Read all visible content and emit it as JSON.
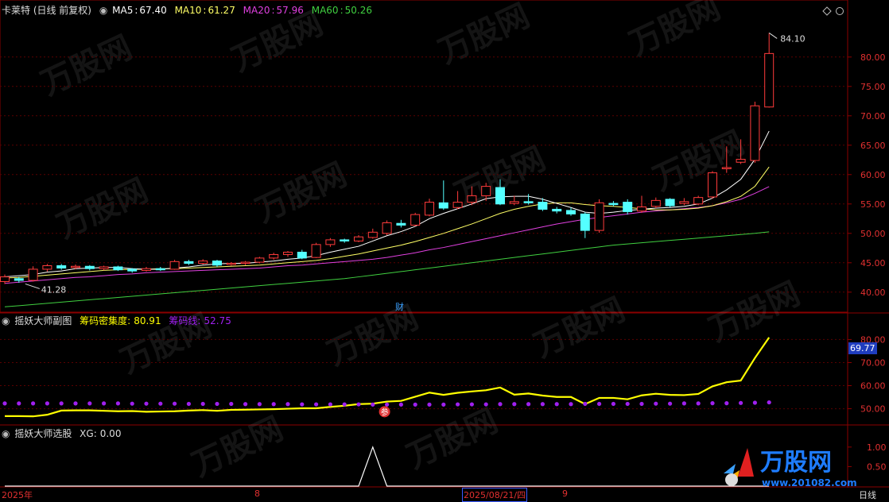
{
  "chart_data": [
    {
      "type": "candlestick",
      "title": "卡莱特 (日线 前复权)",
      "indicators": [
        {
          "name": "MA5",
          "value": "67.40",
          "color": "#ffffff"
        },
        {
          "name": "MA10",
          "value": "61.27",
          "color": "#ffff66"
        },
        {
          "name": "MA20",
          "value": "57.96",
          "color": "#e040e0"
        },
        {
          "name": "MA60",
          "value": "50.26",
          "color": "#40d040"
        }
      ],
      "ylim": [
        37,
        87
      ],
      "yticks": [
        "80.00",
        "75.00",
        "70.00",
        "65.00",
        "60.00",
        "55.00",
        "50.00",
        "45.00",
        "40.00"
      ],
      "high_label": "84.10",
      "low_label": "41.28",
      "annotation": "财",
      "candles": [
        [
          41.8,
          42.6,
          43.0,
          41.4
        ],
        [
          42.3,
          42.0,
          42.6,
          41.6
        ],
        [
          42.0,
          43.9,
          44.4,
          41.8
        ],
        [
          43.9,
          44.5,
          44.8,
          43.5
        ],
        [
          44.5,
          44.1,
          44.8,
          43.8
        ],
        [
          44.2,
          44.4,
          44.7,
          43.9
        ],
        [
          44.4,
          44.0,
          44.6,
          43.7
        ],
        [
          44.0,
          44.3,
          44.5,
          43.7
        ],
        [
          44.3,
          43.8,
          44.5,
          43.6
        ],
        [
          43.9,
          43.6,
          44.1,
          43.3
        ],
        [
          43.7,
          44.0,
          44.3,
          43.5
        ],
        [
          44.0,
          43.8,
          44.3,
          43.6
        ],
        [
          43.9,
          45.2,
          45.5,
          43.8
        ],
        [
          45.2,
          44.9,
          45.5,
          44.6
        ],
        [
          44.9,
          45.3,
          45.6,
          44.7
        ],
        [
          45.3,
          44.6,
          45.5,
          44.3
        ],
        [
          44.7,
          44.9,
          45.1,
          44.5
        ],
        [
          44.9,
          45.1,
          45.3,
          44.6
        ],
        [
          45.1,
          45.8,
          46.0,
          44.9
        ],
        [
          45.8,
          46.4,
          46.7,
          45.5
        ],
        [
          46.4,
          46.8,
          47.0,
          46.0
        ],
        [
          46.8,
          45.8,
          47.2,
          45.6
        ],
        [
          45.9,
          48.1,
          48.4,
          45.8
        ],
        [
          48.1,
          48.9,
          49.2,
          47.7
        ],
        [
          48.9,
          48.7,
          49.1,
          48.4
        ],
        [
          48.7,
          49.4,
          49.7,
          48.5
        ],
        [
          49.3,
          50.2,
          50.8,
          49.1
        ],
        [
          50.0,
          51.8,
          52.2,
          49.7
        ],
        [
          51.7,
          51.4,
          52.3,
          51.0
        ],
        [
          51.4,
          53.2,
          53.5,
          51.2
        ],
        [
          53.1,
          55.3,
          55.9,
          52.9
        ],
        [
          55.2,
          54.3,
          59.0,
          54.0
        ],
        [
          54.4,
          55.3,
          57.2,
          54.1
        ],
        [
          55.3,
          56.4,
          58.0,
          54.8
        ],
        [
          56.4,
          58.0,
          58.6,
          55.5
        ],
        [
          57.8,
          55.0,
          59.2,
          54.8
        ],
        [
          55.1,
          55.4,
          56.4,
          54.8
        ],
        [
          55.4,
          55.2,
          56.7,
          54.9
        ],
        [
          55.3,
          54.1,
          56.0,
          53.8
        ],
        [
          54.1,
          53.8,
          54.5,
          53.4
        ],
        [
          53.9,
          53.3,
          54.4,
          53.0
        ],
        [
          53.3,
          50.5,
          53.6,
          49.2
        ],
        [
          50.5,
          55.2,
          55.8,
          50.1
        ],
        [
          55.1,
          55.0,
          55.5,
          54.6
        ],
        [
          55.3,
          53.7,
          55.8,
          53.2
        ],
        [
          53.8,
          54.5,
          56.4,
          53.5
        ],
        [
          54.6,
          55.6,
          56.1,
          54.3
        ],
        [
          55.8,
          54.7,
          56.0,
          54.4
        ],
        [
          55.1,
          55.4,
          56.0,
          54.8
        ],
        [
          55.0,
          56.1,
          56.4,
          54.8
        ],
        [
          56.2,
          60.3,
          60.6,
          55.9
        ],
        [
          61.2,
          61.2,
          64.8,
          60.3
        ],
        [
          62.1,
          62.6,
          66.0,
          61.8
        ],
        [
          62.4,
          71.7,
          72.4,
          62.0
        ],
        [
          71.5,
          80.6,
          84.1,
          71.4
        ]
      ],
      "series": [
        {
          "name": "MA5",
          "color": "#ffffff",
          "values": [
            42.6,
            42.8,
            43.0,
            43.4,
            43.6,
            44.0,
            44.1,
            44.2,
            44.2,
            44.0,
            43.9,
            43.9,
            44.1,
            44.3,
            44.6,
            44.8,
            44.9,
            44.9,
            45.1,
            45.3,
            45.6,
            45.8,
            46.2,
            46.8,
            47.3,
            47.8,
            48.7,
            49.6,
            50.3,
            51.2,
            52.5,
            53.4,
            54.2,
            55.0,
            55.9,
            56.2,
            56.3,
            56.3,
            55.8,
            55.1,
            54.4,
            53.6,
            53.4,
            53.6,
            53.9,
            54.1,
            54.3,
            54.4,
            54.6,
            55.0,
            56.0,
            57.4,
            59.2,
            62.6,
            67.4
          ]
        },
        {
          "name": "MA10",
          "color": "#ffff66",
          "values": [
            42.4,
            42.5,
            42.7,
            42.9,
            43.1,
            43.3,
            43.5,
            43.7,
            43.8,
            43.9,
            43.9,
            44.0,
            44.0,
            44.1,
            44.2,
            44.3,
            44.4,
            44.5,
            44.6,
            44.8,
            45.0,
            45.2,
            45.4,
            45.7,
            46.1,
            46.5,
            47.0,
            47.5,
            48.0,
            48.6,
            49.3,
            50.0,
            50.8,
            51.6,
            52.5,
            53.4,
            54.1,
            54.6,
            55.0,
            55.2,
            55.2,
            54.9,
            54.7,
            54.6,
            54.4,
            54.2,
            54.0,
            54.0,
            54.1,
            54.3,
            54.7,
            55.4,
            56.3,
            58.0,
            61.3
          ]
        },
        {
          "name": "MA20",
          "color": "#e040e0",
          "values": [
            41.5,
            41.7,
            41.9,
            42.1,
            42.3,
            42.5,
            42.6,
            42.8,
            43.0,
            43.1,
            43.3,
            43.4,
            43.5,
            43.6,
            43.7,
            43.8,
            43.9,
            44.0,
            44.1,
            44.3,
            44.5,
            44.6,
            44.8,
            45.0,
            45.2,
            45.4,
            45.6,
            45.9,
            46.3,
            46.7,
            47.2,
            47.6,
            48.1,
            48.6,
            49.1,
            49.6,
            50.1,
            50.6,
            51.1,
            51.6,
            52.0,
            52.4,
            52.7,
            53.0,
            53.3,
            53.6,
            53.8,
            54.0,
            54.2,
            54.4,
            54.7,
            55.2,
            55.8,
            56.8,
            57.96
          ]
        },
        {
          "name": "MA60",
          "color": "#40d040",
          "values": [
            37.5,
            37.7,
            37.9,
            38.1,
            38.3,
            38.5,
            38.7,
            38.9,
            39.1,
            39.3,
            39.5,
            39.7,
            39.9,
            40.1,
            40.3,
            40.5,
            40.7,
            40.9,
            41.1,
            41.3,
            41.5,
            41.7,
            41.9,
            42.1,
            42.3,
            42.6,
            42.9,
            43.2,
            43.5,
            43.8,
            44.1,
            44.4,
            44.7,
            45.0,
            45.3,
            45.6,
            45.9,
            46.2,
            46.5,
            46.8,
            47.1,
            47.4,
            47.7,
            48.0,
            48.2,
            48.4,
            48.6,
            48.8,
            49.0,
            49.2,
            49.4,
            49.6,
            49.8,
            50.0,
            50.26
          ]
        }
      ]
    },
    {
      "type": "line",
      "title": "摇妖大师副图",
      "ylim": [
        44,
        86
      ],
      "yticks": [
        "80.00",
        "70.00",
        "60.00",
        "50.00"
      ],
      "current_label": "69.77",
      "marker_label": "参",
      "series": [
        {
          "name": "筹码密集度",
          "value": "80.91",
          "color": "#ffff00",
          "values": [
            46.8,
            46.8,
            46.7,
            47.4,
            49.2,
            49.3,
            49.3,
            49.1,
            48.9,
            49.0,
            48.7,
            48.8,
            48.9,
            49.2,
            49.4,
            49.1,
            49.5,
            49.6,
            49.7,
            49.8,
            50.0,
            50.2,
            50.2,
            50.8,
            51.3,
            52.0,
            52.2,
            53.1,
            53.4,
            55.2,
            57.0,
            56.0,
            56.9,
            57.5,
            58.0,
            59.2,
            56.1,
            56.6,
            55.7,
            55.1,
            55.1,
            52.0,
            54.7,
            54.7,
            54.1,
            55.8,
            56.5,
            56.0,
            55.9,
            56.4,
            59.7,
            61.5,
            62.2,
            72.0,
            80.9
          ]
        },
        {
          "name": "筹码线",
          "value": "52.75",
          "color": "#a020f0",
          "values": [
            52.3,
            52.3,
            52.3,
            52.3,
            52.3,
            52.3,
            52.3,
            52.3,
            52.3,
            52.2,
            52.2,
            52.2,
            52.2,
            52.1,
            52.1,
            52.1,
            52.1,
            52.0,
            52.0,
            52.0,
            52.0,
            51.9,
            51.9,
            51.9,
            51.9,
            51.9,
            51.8,
            51.8,
            51.8,
            51.8,
            51.8,
            51.8,
            51.9,
            51.9,
            51.9,
            52.0,
            52.0,
            52.0,
            52.0,
            52.0,
            52.0,
            52.1,
            52.1,
            52.1,
            52.1,
            52.1,
            52.2,
            52.2,
            52.3,
            52.3,
            52.4,
            52.4,
            52.5,
            52.6,
            52.75
          ]
        }
      ]
    },
    {
      "type": "line",
      "title": "摇妖大师选股",
      "ylim": [
        0,
        1.2
      ],
      "yticks": [
        "1.00",
        "0.50"
      ],
      "series": [
        {
          "name": "XG",
          "value": "0.00",
          "color": "#ffffff",
          "values": [
            0,
            0,
            0,
            0,
            0,
            0,
            0,
            0,
            0,
            0,
            0,
            0,
            0,
            0,
            0,
            0,
            0,
            0,
            0,
            0,
            0,
            0,
            0,
            0,
            0,
            0,
            1,
            0,
            0,
            0,
            0,
            0,
            0,
            0,
            0,
            0,
            0,
            0,
            0,
            0,
            0,
            0,
            0,
            0,
            0,
            0,
            0,
            0,
            0,
            0,
            0,
            0,
            0,
            0,
            0
          ]
        }
      ]
    }
  ],
  "xaxis": {
    "labels": [
      "2025年",
      "8",
      "2025/08/21/四",
      "9"
    ],
    "period": "日线"
  },
  "watermark": "万股网",
  "logo": {
    "title": "万股网",
    "url": "www.201082.com"
  }
}
